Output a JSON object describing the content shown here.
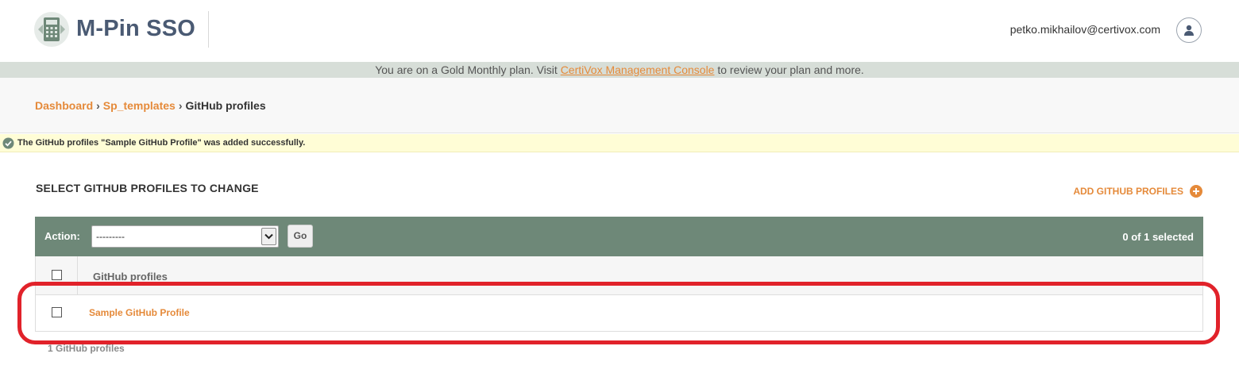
{
  "header": {
    "brand": "M-Pin SSO",
    "user_email": "petko.mikhailov@certivox.com",
    "logo_icon": "calculator-logo-icon",
    "avatar_icon": "user-icon"
  },
  "plan_banner": {
    "prefix": "You are on a Gold Monthly plan. Visit ",
    "link_text": "CertiVox Management Console",
    "suffix": " to review your plan and more."
  },
  "breadcrumbs": {
    "items": [
      "Dashboard",
      "Sp_templates",
      "GitHub profiles"
    ],
    "separator": "›"
  },
  "message": {
    "text": "The GitHub profiles \"Sample GitHub Profile\" was added successfully.",
    "icon": "checkmark-circle-icon"
  },
  "content": {
    "title": "SELECT GITHUB PROFILES TO CHANGE",
    "add_label": "ADD GITHUB PROFILES",
    "add_icon": "plus-circle-icon"
  },
  "actions": {
    "label": "Action:",
    "selected_option": "---------",
    "go_label": "Go",
    "selected_count": "0 of 1 selected"
  },
  "table": {
    "column_header": "GitHub profiles",
    "rows": [
      {
        "label": "Sample GitHub Profile"
      }
    ]
  },
  "paginator": {
    "text": "1 GitHub profiles"
  },
  "colors": {
    "accent": "#e58a3a",
    "brand_text": "#4a5a73",
    "action_bar": "#6e8878",
    "message_bg": "#fffdd6",
    "highlight": "#e1222a"
  }
}
